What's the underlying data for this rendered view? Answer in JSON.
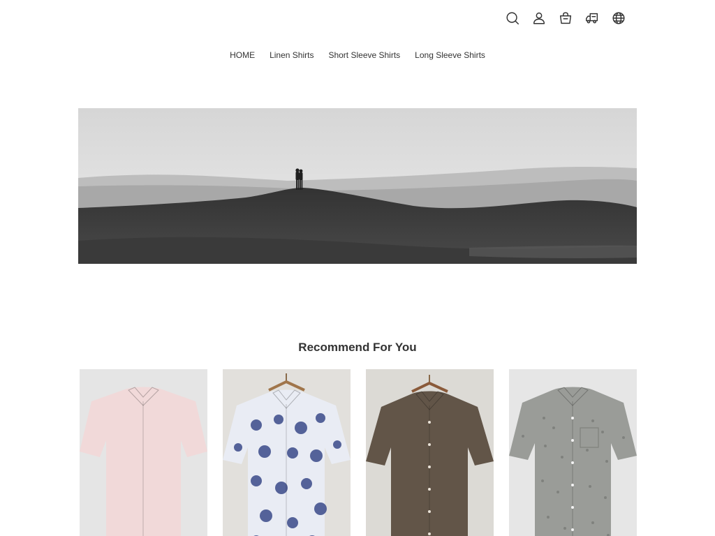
{
  "header": {
    "icons": [
      "search-icon",
      "account-icon",
      "cart-icon",
      "shipping-truck-icon",
      "globe-icon"
    ]
  },
  "nav": {
    "items": [
      {
        "label": "HOME"
      },
      {
        "label": "Linen Shirts"
      },
      {
        "label": "Short Sleeve Shirts"
      },
      {
        "label": "Long Sleeve Shirts"
      }
    ]
  },
  "hero": {
    "image": "couple-on-desert-dune-banner"
  },
  "recommend": {
    "title": "Recommend For You",
    "products": [
      {
        "image": "pink-short-sleeve-shirt",
        "color": "#f1d9d9",
        "background": "#e5e5e5"
      },
      {
        "image": "navy-paisley-short-sleeve-shirt",
        "color": "#e9ecf4",
        "background": "#e2e0dc"
      },
      {
        "image": "brown-short-sleeve-shirt",
        "color": "#625548",
        "background": "#dcdad5"
      },
      {
        "image": "grey-print-short-sleeve-shirt",
        "color": "#9a9c98",
        "background": "#e6e6e6"
      }
    ]
  },
  "colors": {
    "text": "#333333",
    "background": "#ffffff"
  }
}
